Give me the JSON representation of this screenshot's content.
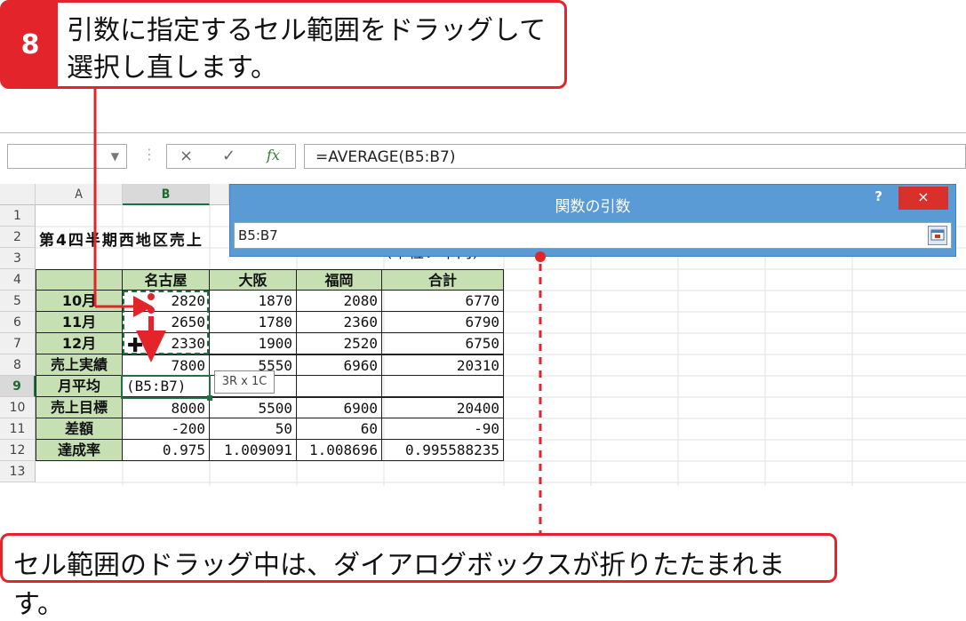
{
  "step": {
    "number": "8",
    "text_line1": "引数に指定するセル範囲をドラッグして",
    "text_line2": "選択し直します。"
  },
  "formula_bar": {
    "cancel_icon": "×",
    "enter_icon": "✓",
    "fx_label": "fx",
    "formula": "=AVERAGE(B5:B7)"
  },
  "columns": [
    "A",
    "B"
  ],
  "rows": [
    "1",
    "2",
    "3",
    "4",
    "5",
    "6",
    "7",
    "8",
    "9",
    "10",
    "11",
    "12",
    "13"
  ],
  "sheet": {
    "title": "第4四半期西地区売上",
    "unit": "（単位：千円）",
    "headers": [
      "名古屋",
      "大阪",
      "福岡",
      "合計"
    ],
    "data_rows": [
      {
        "label": "10月",
        "values": [
          "2820",
          "1870",
          "2080",
          "6770"
        ]
      },
      {
        "label": "11月",
        "values": [
          "2650",
          "1780",
          "2360",
          "6790"
        ]
      },
      {
        "label": "12月",
        "values": [
          "2330",
          "1900",
          "2520",
          "6750"
        ]
      },
      {
        "label": "売上実績",
        "values": [
          "7800",
          "5550",
          "6960",
          "20310"
        ]
      },
      {
        "label": "月平均",
        "values": [
          "(B5:B7)",
          "",
          "",
          ""
        ]
      },
      {
        "label": "売上目標",
        "values": [
          "8000",
          "5500",
          "6900",
          "20400"
        ]
      },
      {
        "label": "差額",
        "values": [
          "-200",
          "50",
          "60",
          "-90"
        ]
      },
      {
        "label": "達成率",
        "values": [
          "0.975",
          "1.009091",
          "1.008696",
          "0.995588235"
        ]
      }
    ]
  },
  "dialog": {
    "title": "関数の引数",
    "help": "?",
    "close": "×",
    "input_value": "B5:B7"
  },
  "tooltip": "3R x 1C",
  "note": "セル範囲のドラッグ中は、ダイアログボックスが折りたたまれます。",
  "colors": {
    "accent": "#e3242b",
    "header_green": "#c6e0b4",
    "dialog_blue": "#5b9bd5",
    "selection_green": "#1e7145"
  }
}
